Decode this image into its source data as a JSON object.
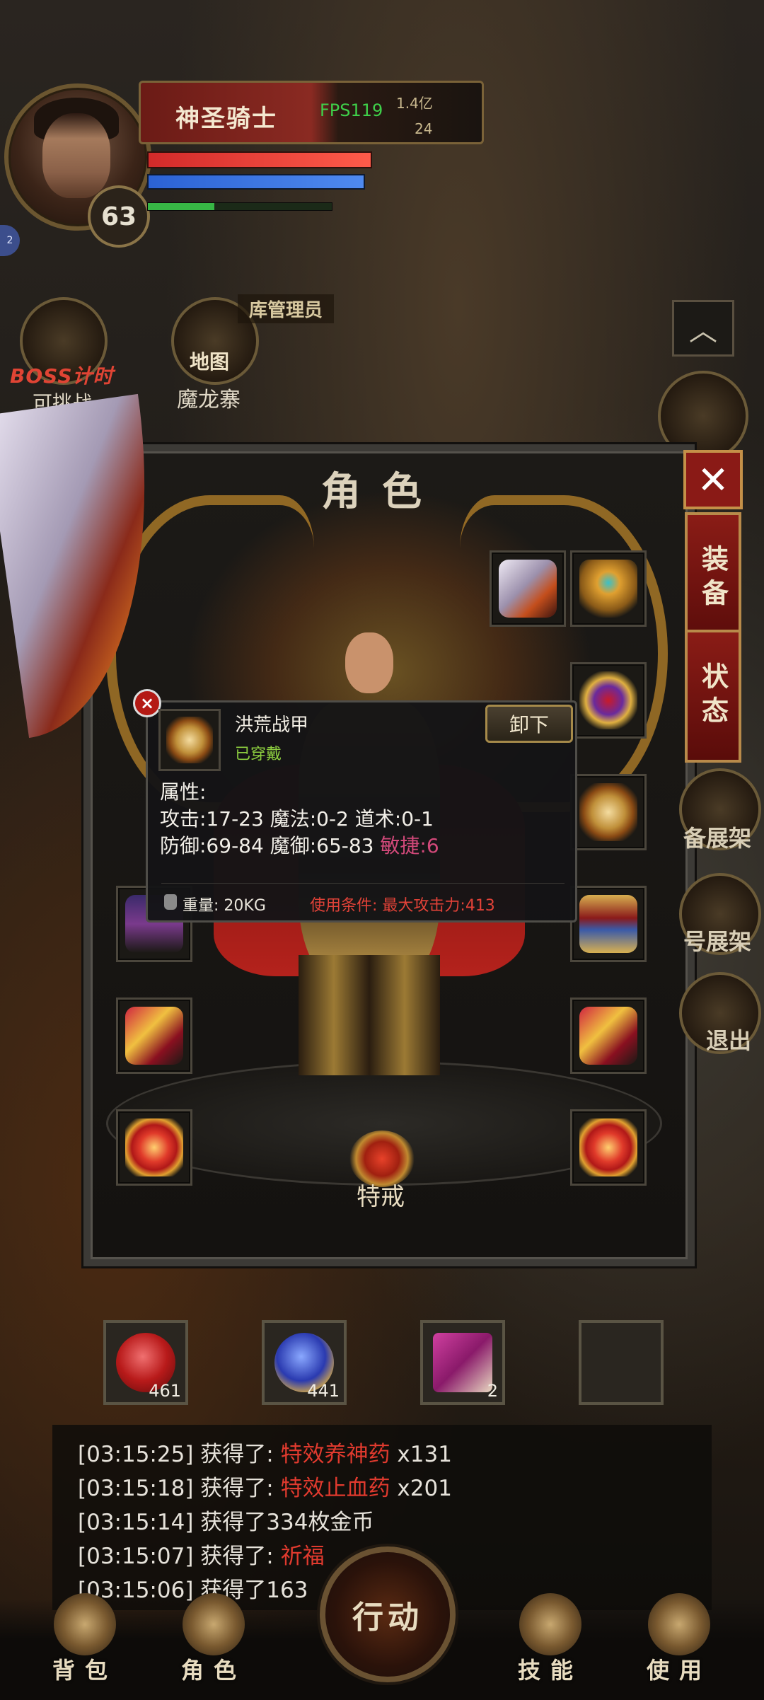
{
  "player": {
    "name": "神圣骑士",
    "level": "63",
    "fps": "FPS119",
    "currency_1": "1.4亿",
    "currency_2": "24"
  },
  "hud": {
    "side_badge": "2",
    "boss_timer_label": "BOSS计时",
    "boss_timer_status": "可挑战",
    "map_label": "地图",
    "map_location": "魔龙寨",
    "npc_label": "库管理员",
    "collapse_icon": "chevron-up-icon"
  },
  "panel": {
    "title": "角色",
    "close_label": "✕",
    "tabs": [
      "装备",
      "状态"
    ],
    "special_ring_label": "特戒",
    "side_buttons": [
      "备展架",
      "号展架",
      "退出"
    ]
  },
  "tooltip": {
    "item_name": "洪荒战甲",
    "equipped_status": "已穿戴",
    "unequip_label": "卸下",
    "attributes_header": "属性:",
    "attr_line1": "攻击:17-23  魔法:0-2  道术:0-1",
    "attr_line2_base": "防御:69-84  魔御:65-83",
    "attr_agility": "敏捷:6",
    "weight": "重量:  20KG",
    "use_condition": "使用条件:  最大攻击力:413",
    "colors": {
      "agility": "#d2497a",
      "condition": "#e24238",
      "equipped": "#8ed040"
    }
  },
  "quickslots": [
    {
      "icon": "red-potion-icon",
      "count": "461"
    },
    {
      "icon": "blue-potion-icon",
      "count": "441"
    },
    {
      "icon": "scroll-icon",
      "count": "2"
    },
    {
      "icon": "",
      "count": ""
    }
  ],
  "chat": [
    {
      "time": "[03:15:25]",
      "prefix": " 获得了: ",
      "item": "特效养神药",
      "suffix": " x131"
    },
    {
      "time": "[03:15:18]",
      "prefix": " 获得了: ",
      "item": "特效止血药",
      "suffix": " x201"
    },
    {
      "time": "[03:15:14]",
      "prefix": " 获得了334枚金币",
      "item": "",
      "suffix": ""
    },
    {
      "time": "[03:15:07]",
      "prefix": " 获得了: ",
      "item": "祈福",
      "suffix": ""
    },
    {
      "time": "[03:15:06]",
      "prefix": " 获得了163",
      "item": "",
      "suffix": ""
    }
  ],
  "bottom_nav": {
    "action_label": "行动",
    "items": [
      "背包",
      "角色",
      "技能",
      "使用"
    ]
  }
}
